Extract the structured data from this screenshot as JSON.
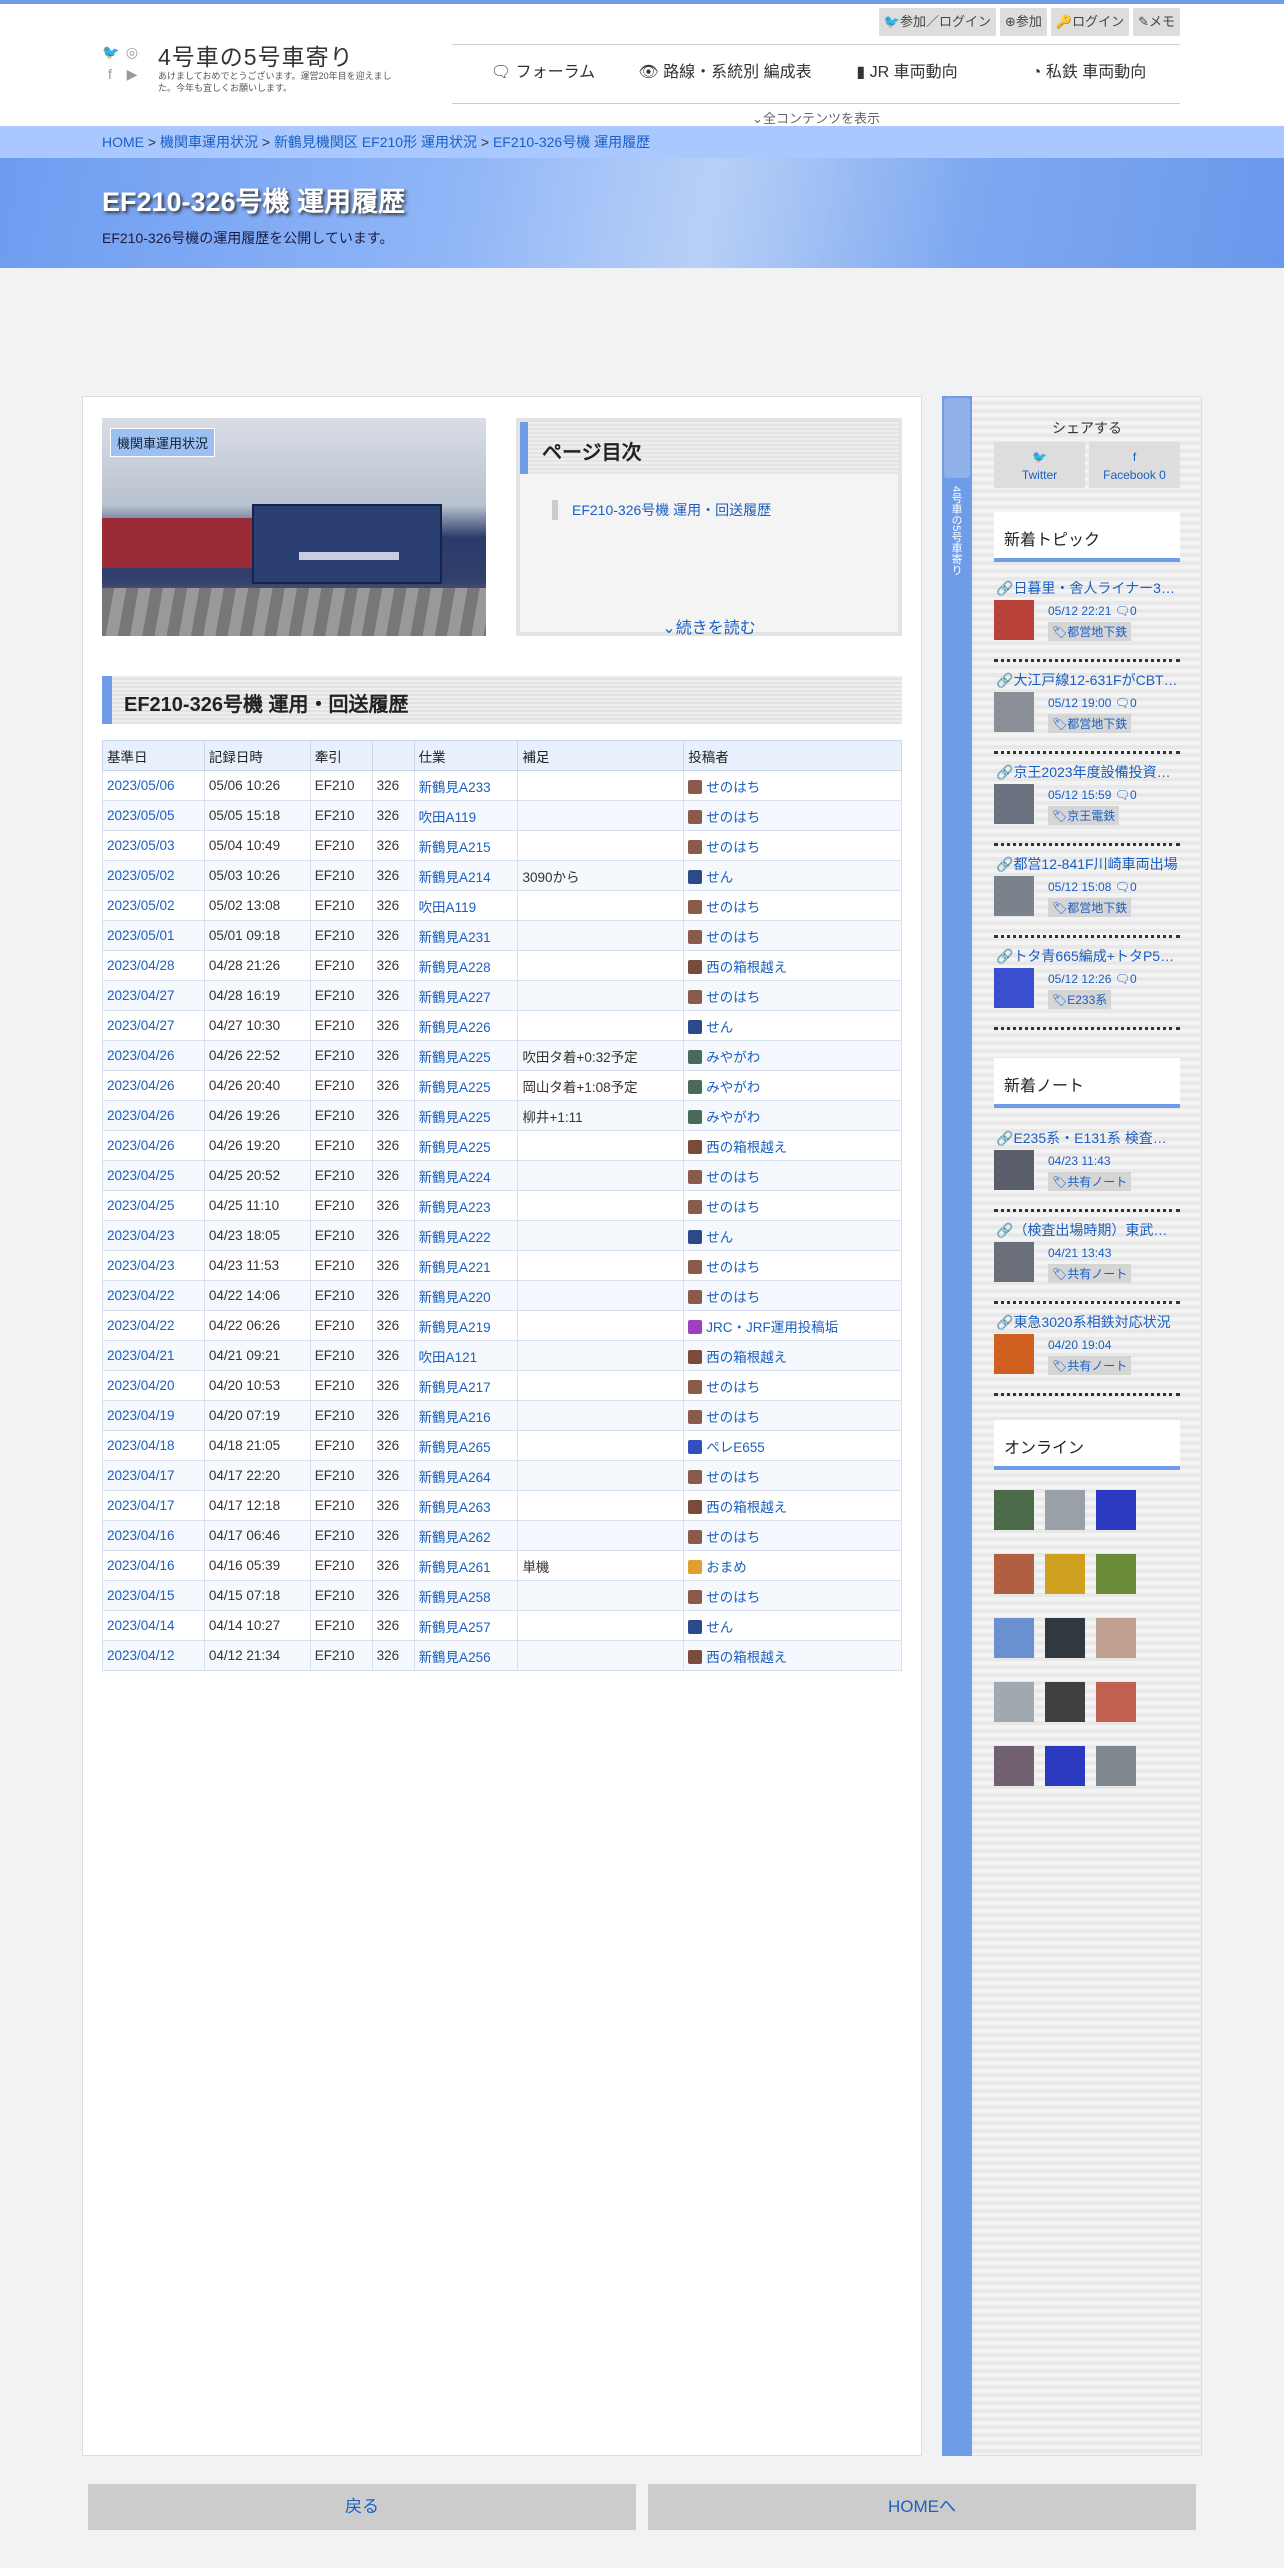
{
  "site": {
    "title": "4号車の5号車寄り",
    "subtitle": "あけましておめでとうございます。運営20年目を迎えました。今年も宜しくお願いします。",
    "social_icons": [
      "twitter-icon",
      "instagram-icon",
      "facebook-icon",
      "youtube-icon"
    ]
  },
  "topbuttons": [
    "参加／ログイン",
    "参加",
    "ログイン",
    "メモ"
  ],
  "nav": [
    "フォーラム",
    "路線・系統別 編成表",
    "JR 車両動向",
    "私鉄 車両動向"
  ],
  "show_all": "全コンテンツを表示",
  "breadcrumb": [
    "HOME",
    "機関車運用状況",
    "新鶴見機関区 EF210形 運用状況",
    "EF210-326号機 運用履歴"
  ],
  "page": {
    "title": "EF210-326号機 運用履歴",
    "description": "EF210-326号機の運用履歴を公開しています。",
    "photo_tag": "機関車運用状況"
  },
  "toc": {
    "title": "ページ目次",
    "item": "EF210-326号機 運用・回送履歴",
    "more": "続きを読む"
  },
  "section_title": "EF210-326号機 運用・回送履歴",
  "table": {
    "headers": [
      "基準日",
      "記録日時",
      "牽引",
      "",
      "仕業",
      "補足",
      "投稿者"
    ],
    "rows": [
      [
        "2023/05/06",
        "05/06 10:26",
        "EF210",
        "326",
        "新鶴見A233",
        "",
        "せのはち"
      ],
      [
        "2023/05/05",
        "05/05 15:18",
        "EF210",
        "326",
        "吹田A119",
        "",
        "せのはち"
      ],
      [
        "2023/05/03",
        "05/04 10:49",
        "EF210",
        "326",
        "新鶴見A215",
        "",
        "せのはち"
      ],
      [
        "2023/05/02",
        "05/03 10:26",
        "EF210",
        "326",
        "新鶴見A214",
        "3090から",
        "せん"
      ],
      [
        "2023/05/02",
        "05/02 13:08",
        "EF210",
        "326",
        "吹田A119",
        "",
        "せのはち"
      ],
      [
        "2023/05/01",
        "05/01 09:18",
        "EF210",
        "326",
        "新鶴見A231",
        "",
        "せのはち"
      ],
      [
        "2023/04/28",
        "04/28 21:26",
        "EF210",
        "326",
        "新鶴見A228",
        "",
        "西の箱根越え"
      ],
      [
        "2023/04/27",
        "04/28 16:19",
        "EF210",
        "326",
        "新鶴見A227",
        "",
        "せのはち"
      ],
      [
        "2023/04/27",
        "04/27 10:30",
        "EF210",
        "326",
        "新鶴見A226",
        "",
        "せん"
      ],
      [
        "2023/04/26",
        "04/26 22:52",
        "EF210",
        "326",
        "新鶴見A225",
        "吹田タ着+0:32予定",
        "みやがわ"
      ],
      [
        "2023/04/26",
        "04/26 20:40",
        "EF210",
        "326",
        "新鶴見A225",
        "岡山タ着+1:08予定",
        "みやがわ"
      ],
      [
        "2023/04/26",
        "04/26 19:26",
        "EF210",
        "326",
        "新鶴見A225",
        "柳井+1:11",
        "みやがわ"
      ],
      [
        "2023/04/26",
        "04/26 19:20",
        "EF210",
        "326",
        "新鶴見A225",
        "",
        "西の箱根越え"
      ],
      [
        "2023/04/25",
        "04/25 20:52",
        "EF210",
        "326",
        "新鶴見A224",
        "",
        "せのはち"
      ],
      [
        "2023/04/25",
        "04/25 11:10",
        "EF210",
        "326",
        "新鶴見A223",
        "",
        "せのはち"
      ],
      [
        "2023/04/23",
        "04/23 18:05",
        "EF210",
        "326",
        "新鶴見A222",
        "",
        "せん"
      ],
      [
        "2023/04/23",
        "04/23 11:53",
        "EF210",
        "326",
        "新鶴見A221",
        "",
        "せのはち"
      ],
      [
        "2023/04/22",
        "04/22 14:06",
        "EF210",
        "326",
        "新鶴見A220",
        "",
        "せのはち"
      ],
      [
        "2023/04/22",
        "04/22 06:26",
        "EF210",
        "326",
        "新鶴見A219",
        "",
        "JRC・JRF運用投稿垢"
      ],
      [
        "2023/04/21",
        "04/21 09:21",
        "EF210",
        "326",
        "吹田A121",
        "",
        "西の箱根越え"
      ],
      [
        "2023/04/20",
        "04/20 10:53",
        "EF210",
        "326",
        "新鶴見A217",
        "",
        "せのはち"
      ],
      [
        "2023/04/19",
        "04/20 07:19",
        "EF210",
        "326",
        "新鶴見A216",
        "",
        "せのはち"
      ],
      [
        "2023/04/18",
        "04/18 21:05",
        "EF210",
        "326",
        "新鶴見A265",
        "",
        "ぺレE655"
      ],
      [
        "2023/04/17",
        "04/17 22:20",
        "EF210",
        "326",
        "新鶴見A264",
        "",
        "せのはち"
      ],
      [
        "2023/04/17",
        "04/17 12:18",
        "EF210",
        "326",
        "新鶴見A263",
        "",
        "西の箱根越え"
      ],
      [
        "2023/04/16",
        "04/17 06:46",
        "EF210",
        "326",
        "新鶴見A262",
        "",
        "せのはち"
      ],
      [
        "2023/04/16",
        "04/16 05:39",
        "EF210",
        "326",
        "新鶴見A261",
        "単機",
        "おまめ"
      ],
      [
        "2023/04/15",
        "04/15 07:18",
        "EF210",
        "326",
        "新鶴見A258",
        "",
        "せのはち"
      ],
      [
        "2023/04/14",
        "04/14 10:27",
        "EF210",
        "326",
        "新鶴見A257",
        "",
        "せん"
      ],
      [
        "2023/04/12",
        "04/12 21:34",
        "EF210",
        "326",
        "新鶴見A256",
        "",
        "西の箱根越え"
      ]
    ]
  },
  "sidebar": {
    "vertical_text": "4号車の5号車寄り",
    "share_label": "シェアする",
    "twitter": "Twitter",
    "facebook": "Facebook",
    "facebook_count": "0",
    "topics_header": "新着トピック",
    "topics": [
      {
        "title": "日暮里・舎人ライナー3…",
        "date": "05/12 22:21",
        "count": "0",
        "tag": "都営地下鉄"
      },
      {
        "title": "大江戸線12-631FがCBT…",
        "date": "05/12 19:00",
        "count": "0",
        "tag": "都営地下鉄"
      },
      {
        "title": "京王2023年度設備投資…",
        "date": "05/12 15:59",
        "count": "0",
        "tag": "京王電鉄"
      },
      {
        "title": "都営12-841F川崎車両出場",
        "date": "05/12 15:08",
        "count": "0",
        "tag": "都営地下鉄"
      },
      {
        "title": "トタ青665編成+トタP5…",
        "date": "05/12 12:26",
        "count": "0",
        "tag": "E233系"
      }
    ],
    "notes_header": "新着ノート",
    "notes": [
      {
        "title": "E235系・E131系 検査…",
        "date": "04/23 11:43",
        "tag": "共有ノート"
      },
      {
        "title": "（検査出場時期）東武…",
        "date": "04/21 13:43",
        "tag": "共有ノート"
      },
      {
        "title": "東急3020系相鉄対応状況",
        "date": "04/20 19:04",
        "tag": "共有ノート"
      }
    ],
    "online_header": "オンライン"
  },
  "footer": {
    "back": "戻る",
    "home": "HOMEへ"
  },
  "colors": {
    "accent": "#6f9ce8",
    "link": "#1b5fc1",
    "breadcrumb_bg": "#a8c8ff"
  }
}
